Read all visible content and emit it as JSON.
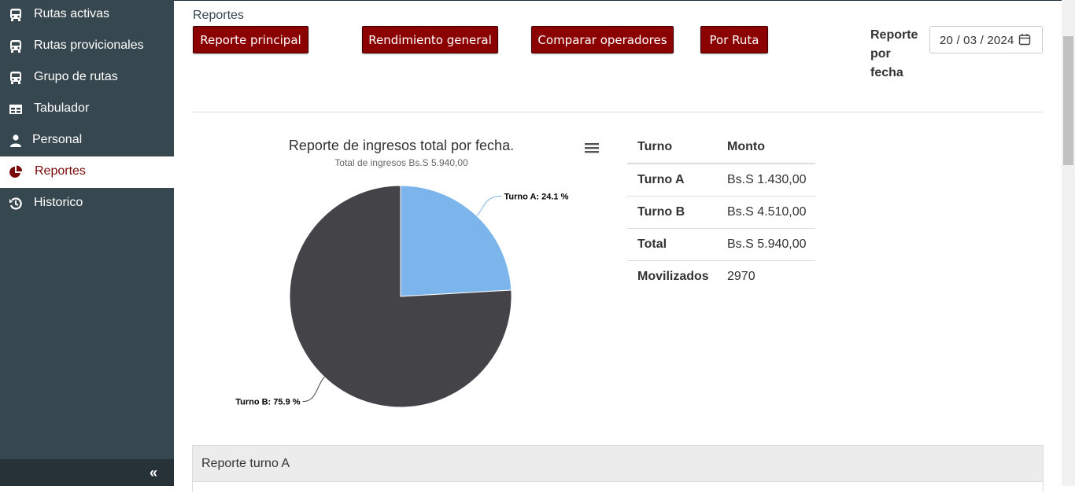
{
  "sidebar": {
    "items": [
      {
        "label": "Rutas activas",
        "icon": "bus-icon",
        "active": false
      },
      {
        "label": "Rutas provicionales",
        "icon": "bus-icon",
        "active": false
      },
      {
        "label": "Grupo de rutas",
        "icon": "bus-icon",
        "active": false
      },
      {
        "label": "Tabulador",
        "icon": "table-icon",
        "active": false
      },
      {
        "label": "Personal",
        "icon": "user-icon",
        "active": false
      },
      {
        "label": "Reportes",
        "icon": "pie-chart-icon",
        "active": true
      },
      {
        "label": "Historico",
        "icon": "history-icon",
        "active": false
      }
    ],
    "collapse_icon": "double-chevron-left-icon",
    "collapse_glyph": "«"
  },
  "header": {
    "section_title": "Reportes",
    "buttons": [
      "Reporte principal",
      "Rendimiento general",
      "Comparar operadores",
      "Por Ruta"
    ],
    "date_label": "Reporte por fecha",
    "date_value": "20 / 03 / 2024",
    "calendar_icon": "calendar-icon"
  },
  "chart": {
    "title": "Reporte de ingresos total por fecha.",
    "subtitle": "Total de ingresos Bs.S 5.940,00",
    "menu_icon": "hamburger-menu-icon"
  },
  "chart_data": {
    "type": "pie",
    "title": "Reporte de ingresos total por fecha.",
    "subtitle": "Total de ingresos Bs.S 5.940,00",
    "slices": [
      {
        "label": "Turno A",
        "value": 24.1,
        "display": "Turno A: 24.1 %",
        "color": "#7cb5ec"
      },
      {
        "label": "Turno B",
        "value": 75.9,
        "display": "Turno B: 75.9 %",
        "color": "#434348"
      }
    ]
  },
  "summary_table": {
    "headers": [
      "Turno",
      "Monto"
    ],
    "rows": [
      [
        "Turno A",
        "Bs.S 1.430,00"
      ],
      [
        "Turno B",
        "Bs.S 4.510,00"
      ],
      [
        "Total",
        "Bs.S 5.940,00"
      ],
      [
        "Movilizados",
        "2970"
      ]
    ]
  },
  "panel": {
    "title": "Reporte turno A"
  },
  "colors": {
    "sidebar_bg": "#37474f",
    "accent": "#8b0000",
    "active_text": "#7a0a0a"
  }
}
